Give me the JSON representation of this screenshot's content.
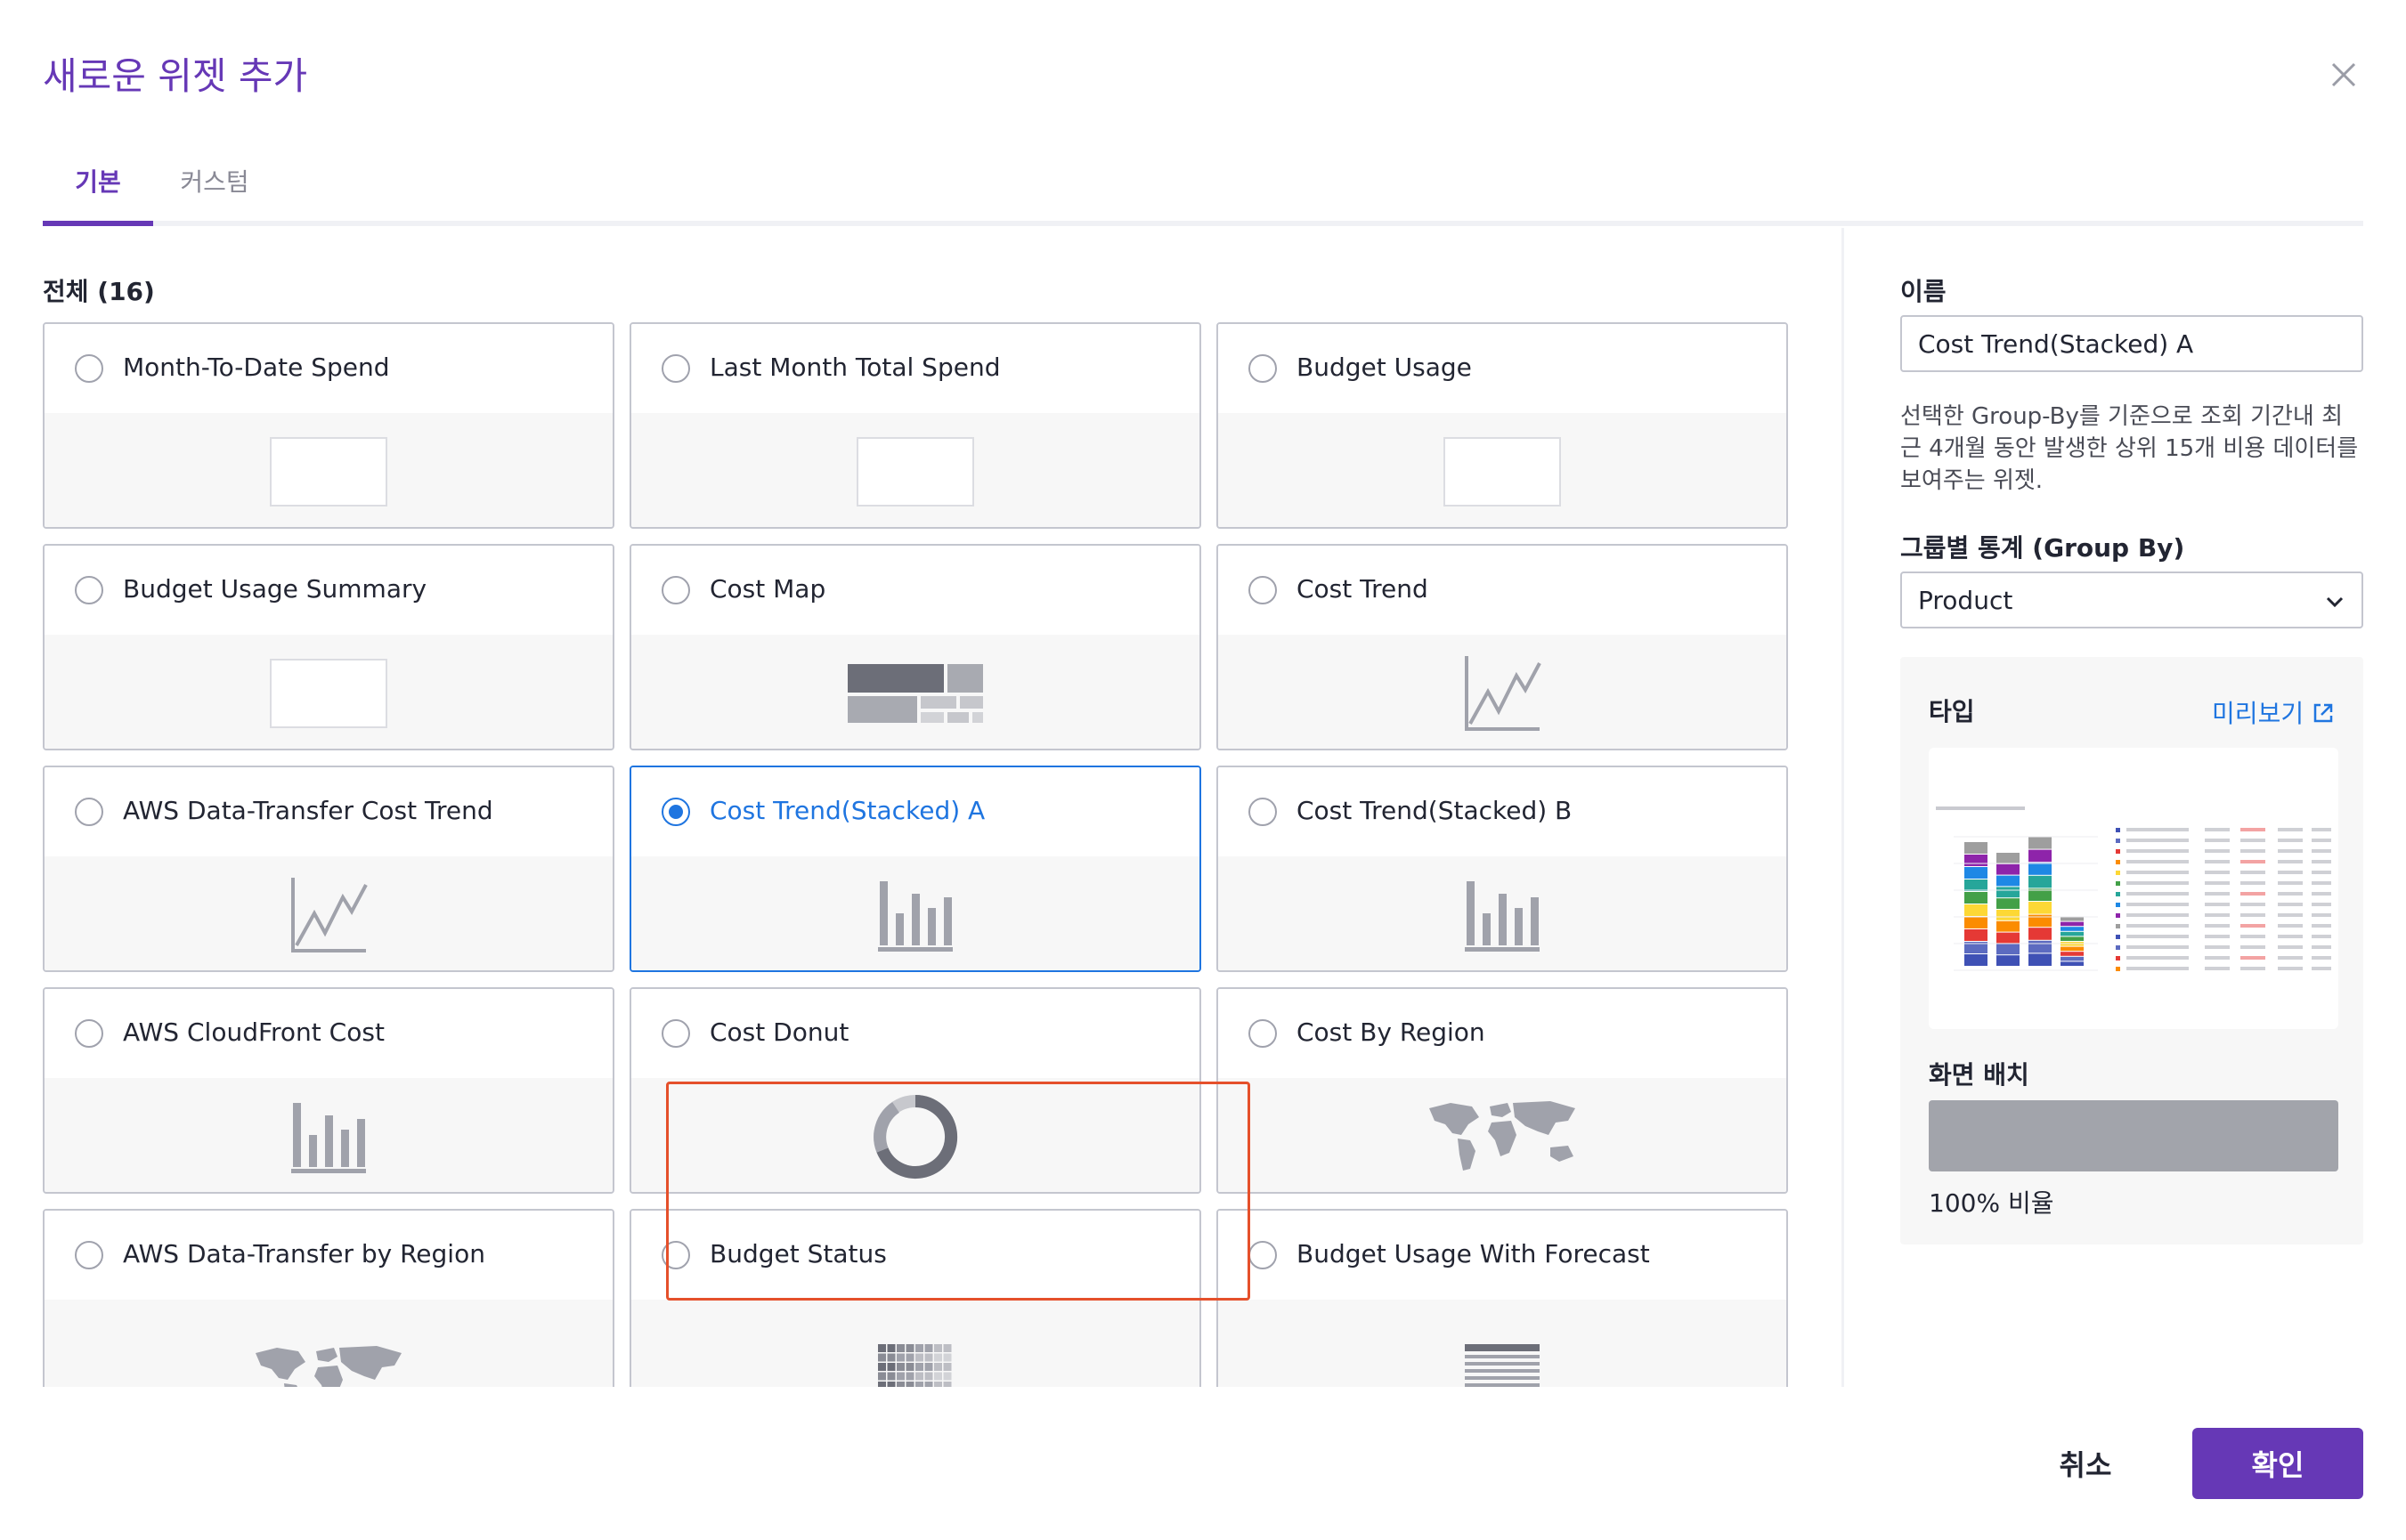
{
  "modal": {
    "title": "새로운 위젯 추가"
  },
  "tabs": [
    {
      "label": "기본",
      "active": true
    },
    {
      "label": "커스텀",
      "active": false
    }
  ],
  "widget_list": {
    "section_label": "전체 (16)",
    "widgets": [
      {
        "name": "Month-To-Date Spend",
        "thumb": "blank-box"
      },
      {
        "name": "Last Month Total Spend",
        "thumb": "blank-box"
      },
      {
        "name": "Budget Usage",
        "thumb": "blank-box"
      },
      {
        "name": "Budget Usage Summary",
        "thumb": "blank-box"
      },
      {
        "name": "Cost Map",
        "thumb": "treemap-icon"
      },
      {
        "name": "Cost Trend",
        "thumb": "line-chart-icon"
      },
      {
        "name": "AWS Data-Transfer Cost Trend",
        "thumb": "line-chart-icon"
      },
      {
        "name": "Cost Trend(Stacked) A",
        "thumb": "bar-chart-icon",
        "selected": true
      },
      {
        "name": "Cost Trend(Stacked) B",
        "thumb": "bar-chart-icon"
      },
      {
        "name": "AWS CloudFront Cost",
        "thumb": "bar-chart-icon"
      },
      {
        "name": "Cost Donut",
        "thumb": "donut-icon"
      },
      {
        "name": "Cost By Region",
        "thumb": "world-map-icon"
      },
      {
        "name": "AWS Data-Transfer by Region",
        "thumb": "world-map-icon"
      },
      {
        "name": "Budget Status",
        "thumb": "grid-icon"
      },
      {
        "name": "Budget Usage With Forecast",
        "thumb": "stripes-icon"
      }
    ]
  },
  "settings": {
    "name_label": "이름",
    "name_value": "Cost Trend(Stacked) A",
    "description": "선택한 Group-By를 기준으로 조회 기간내 최근 4개월 동안 발생한 상위 15개 비용 데이터를 보여주는 위젯.",
    "group_by_label": "그룹별 통계 (Group By)",
    "group_by_value": "Product",
    "type_label": "타입",
    "preview_label": "미리보기",
    "layout_label": "화면 배치",
    "layout_ratio_text": "100% 비율"
  },
  "footer": {
    "cancel_label": "취소",
    "confirm_label": "확인"
  },
  "colors": {
    "accent": "#6638b6",
    "selected_blue": "#1f75e0",
    "selection_outline": "#e5502b"
  }
}
